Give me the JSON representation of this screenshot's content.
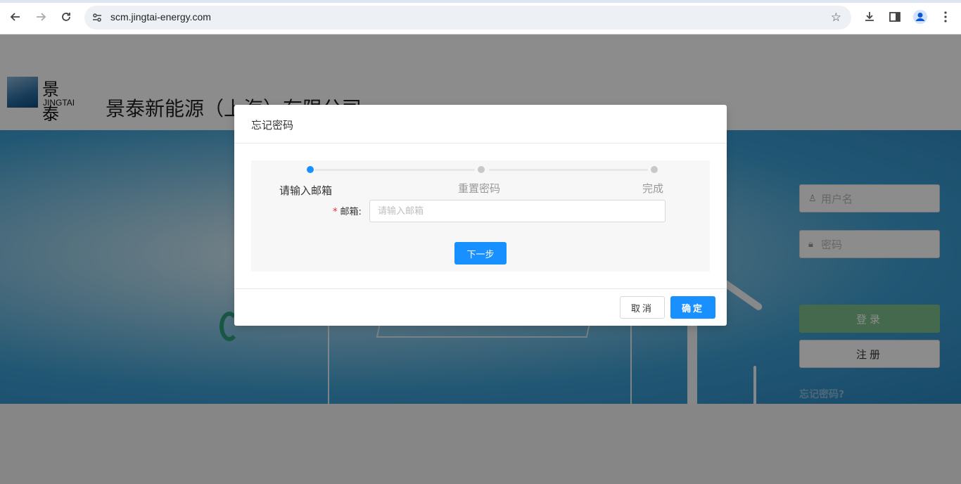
{
  "browser": {
    "url": "scm.jingtai-energy.com",
    "icons": [
      "back-arrow-icon",
      "forward-arrow-icon",
      "reload-icon",
      "site-info-icon",
      "bookmark-star-icon",
      "download-icon",
      "side-panel-icon",
      "profile-icon",
      "more-menu-icon"
    ]
  },
  "header": {
    "logo_cn": "景泰",
    "logo_en": "JINGTAI",
    "company_name": "景泰新能源（上海）有限公司"
  },
  "login": {
    "username_placeholder": "用户名",
    "password_placeholder": "密码",
    "login_label": "登录",
    "register_label": "注册",
    "forgot_label": "忘记密码?",
    "login_color": "#7fbf8c"
  },
  "dialog": {
    "title": "忘记密码",
    "steps": [
      {
        "label": "请输入邮箱",
        "active": true
      },
      {
        "label": "重置密码",
        "active": false
      },
      {
        "label": "完成",
        "active": false
      }
    ],
    "email_label": "邮箱",
    "email_required_mark": "*",
    "email_placeholder": "请输入邮箱",
    "email_value": "",
    "next_label": "下一步",
    "cancel_label": "取消",
    "ok_label": "确定",
    "accent": "#1890ff"
  }
}
